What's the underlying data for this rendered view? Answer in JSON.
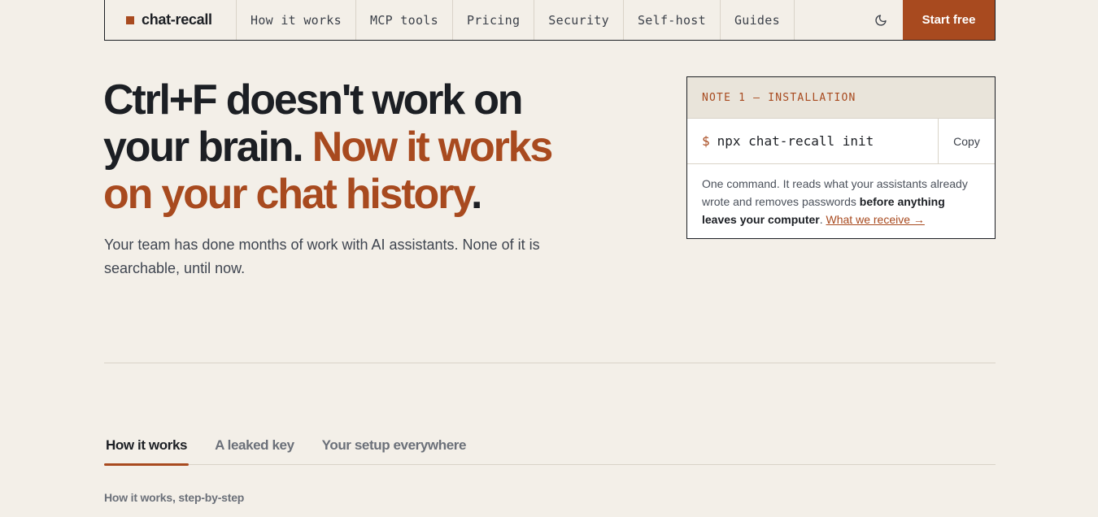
{
  "nav": {
    "brand": "chat-recall",
    "links": [
      "How it works",
      "MCP tools",
      "Pricing",
      "Security",
      "Self-host",
      "Guides"
    ],
    "theme_icon": "moon-icon",
    "cta": "Start free"
  },
  "hero": {
    "title_part1": "Ctrl+F doesn't work on your brain. ",
    "title_accent": "Now it works on your chat history",
    "title_end": ".",
    "subtitle": "Your team has done months of work with AI assistants. None of it is searchable, until now."
  },
  "install_note": {
    "heading": "NOTE 1 — INSTALLATION",
    "prompt": "$",
    "command": "npx chat-recall init",
    "copy_label": "Copy",
    "body_part1": "One command. It reads what your assistants already wrote and removes passwords ",
    "body_bold": "before anything leaves your computer",
    "body_part2": ". ",
    "link_text": "What we receive →"
  },
  "tabs": {
    "items": [
      "How it works",
      "A leaked key",
      "Your setup everywhere"
    ],
    "active_index": 0
  },
  "section": {
    "label": "How it works, step-by-step"
  },
  "colors": {
    "accent": "#a84a1f",
    "background": "#f3efe8",
    "text": "#1c1f24"
  }
}
